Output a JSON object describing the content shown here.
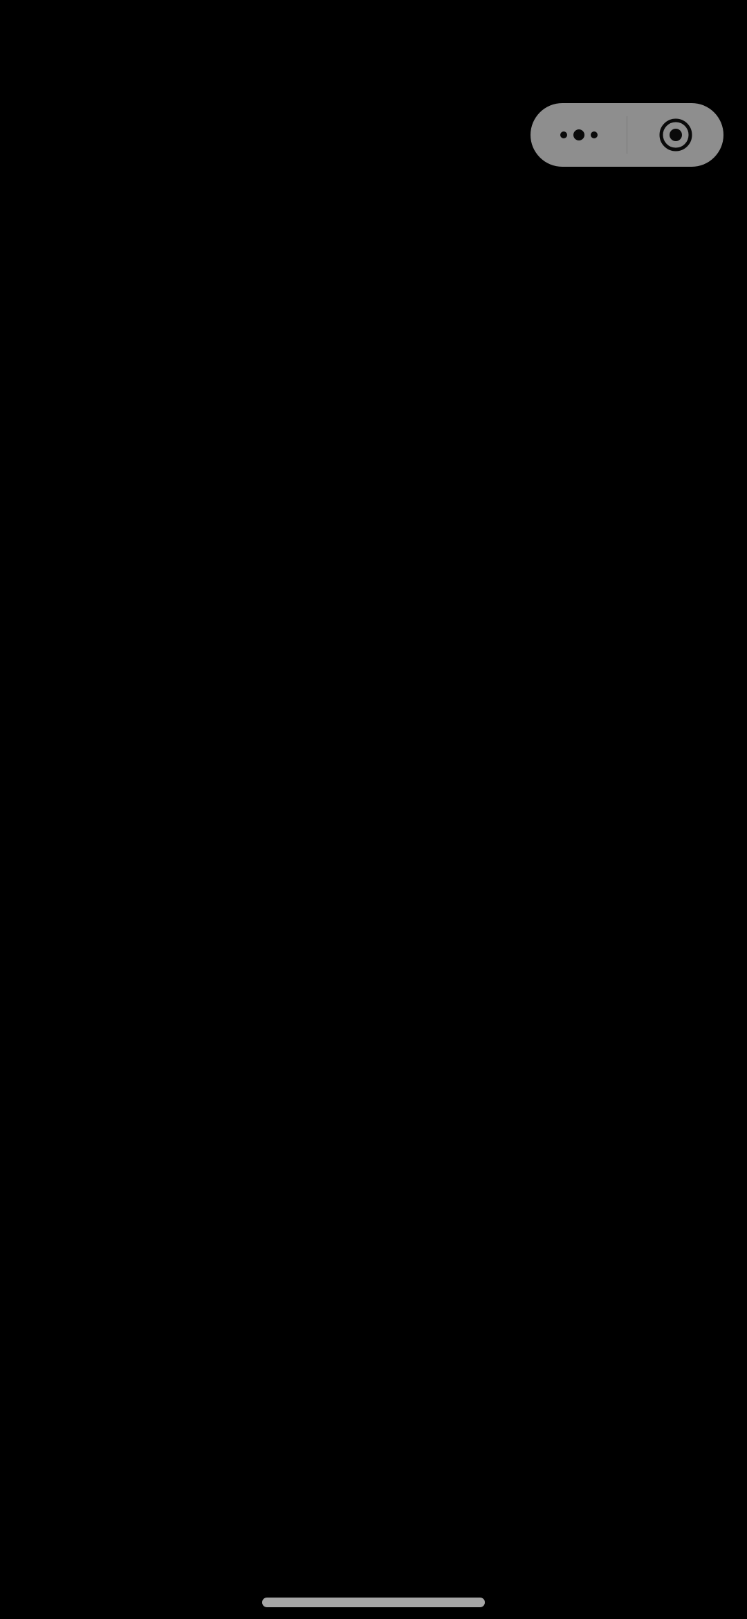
{
  "screen": {
    "background_color": "#000000"
  },
  "capsule": {
    "background_color": "#8e8e8e",
    "icon_color": "#0a0a0a",
    "more_button_icon": "more-dots-icon",
    "close_button_icon": "target-close-icon"
  },
  "home_indicator": {
    "color": "#a6a6a6"
  }
}
